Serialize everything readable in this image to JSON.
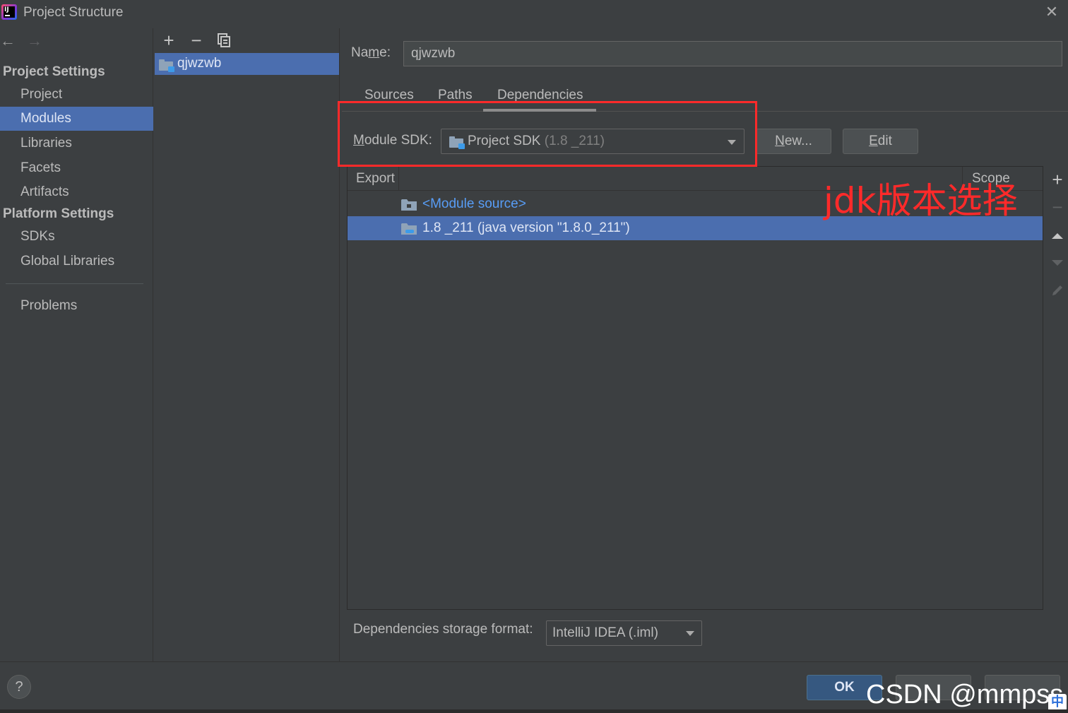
{
  "window": {
    "title": "Project Structure",
    "app_icon": "intellij-idea-icon",
    "app_icon_text": "IJ",
    "close_icon": "close-icon"
  },
  "nav": {
    "back_icon": "arrow-left-icon",
    "forward_icon": "arrow-right-icon",
    "project_settings_header": "Project Settings",
    "platform_settings_header": "Platform Settings",
    "items": {
      "project": "Project",
      "modules": "Modules",
      "libraries": "Libraries",
      "facets": "Facets",
      "artifacts": "Artifacts",
      "sdks": "SDKs",
      "global_libraries": "Global Libraries",
      "problems": "Problems"
    },
    "selected": "Modules"
  },
  "modules_panel": {
    "toolbar": {
      "add_icon": "plus-icon",
      "remove_icon": "minus-icon",
      "copy_icon": "copy-icon"
    },
    "module_name": "qjwzwb"
  },
  "details": {
    "name_label_pre": "Na",
    "name_label_u": "m",
    "name_label_post": "e:",
    "name_value": "qjwzwb",
    "tabs": [
      "Sources",
      "Paths",
      "Dependencies"
    ],
    "active_tab": "Dependencies",
    "sdk_label_u": "M",
    "sdk_label_rest": "odule SDK:",
    "sdk_value": "Project SDK",
    "sdk_version": "(1.8 _211)",
    "new_button_u": "N",
    "new_button_rest": "ew...",
    "edit_button_u": "E",
    "edit_button_rest": "dit",
    "table": {
      "headers": {
        "export": "Export",
        "scope": "Scope"
      },
      "rows": [
        {
          "text": "<Module source>",
          "icon": "module-source-folder-icon"
        },
        {
          "text": "1.8 _211 (java version \"1.8.0_211\")",
          "icon": "jdk-folder-icon",
          "selected": true
        }
      ]
    },
    "side_toolbar": [
      "plus-icon",
      "minus-icon",
      "move-up-icon",
      "move-down-icon",
      "edit-pencil-icon"
    ],
    "storage_label": "Dependencies storage format:",
    "storage_value": "IntelliJ IDEA (.iml)"
  },
  "annotation": "jdk版本选择",
  "footer": {
    "help_label": "?",
    "ok_label": "OK",
    "watermark": "CSDN @mmpss",
    "ime_label": "中"
  },
  "colors": {
    "background": "#3c3f41",
    "selection": "#4b6eaf",
    "highlight_box": "#ff2a2a",
    "link": "#589df6",
    "ok_button": "#365880"
  }
}
